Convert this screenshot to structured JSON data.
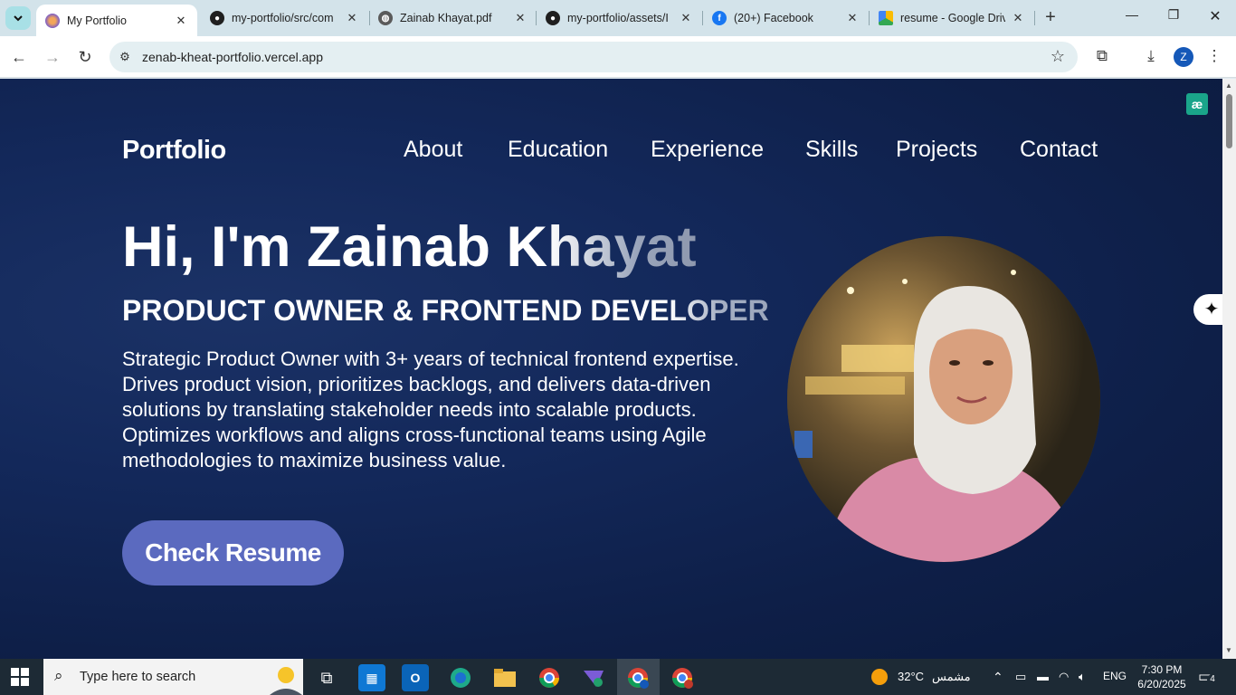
{
  "tabs": [
    {
      "title": "My Portfolio",
      "favicon": "portfolio-icon",
      "active": true
    },
    {
      "title": "my-portfolio/src/com",
      "favicon": "github-icon"
    },
    {
      "title": "Zainab Khayat.pdf",
      "favicon": "globe-icon"
    },
    {
      "title": "my-portfolio/assets/I",
      "favicon": "github-icon"
    },
    {
      "title": "(20+) Facebook",
      "favicon": "facebook-icon"
    },
    {
      "title": "resume - Google Driv",
      "favicon": "google-drive-icon"
    }
  ],
  "toolbar": {
    "url": "zenab-kheat-portfolio.vercel.app",
    "profile_initial": "Z"
  },
  "page": {
    "logo": "Portfolio",
    "nav": [
      "About",
      "Education",
      "Experience",
      "Skills",
      "Projects",
      "Contact"
    ],
    "headline_main": "Hi, I'm Zainab K",
    "headline_fade": "hayat",
    "role_main": "PRODUCT OWNER & FRONTEND DEVE",
    "role_fade": "LOPER",
    "bio": "Strategic Product Owner with 3+ years of technical frontend expertise. Drives product vision, prioritizes backlogs, and delivers data-driven solutions by translating stakeholder needs into scalable products. Optimizes workflows and aligns cross-functional teams using Agile methodologies to maximize business value.",
    "cta": "Check Resume",
    "ext_badge": "æ"
  },
  "taskbar": {
    "search_placeholder": "Type here to search",
    "weather_temp": "32°C",
    "weather_desc": "مشمس",
    "language": "ENG",
    "time": "7:30 PM",
    "date": "6/20/2025",
    "notification_count": "4"
  },
  "colors": {
    "page_bg": "#13285a",
    "cta_bg": "#5b6abf",
    "tab_bar": "#d3e3ea",
    "taskbar": "#1d2a35"
  }
}
